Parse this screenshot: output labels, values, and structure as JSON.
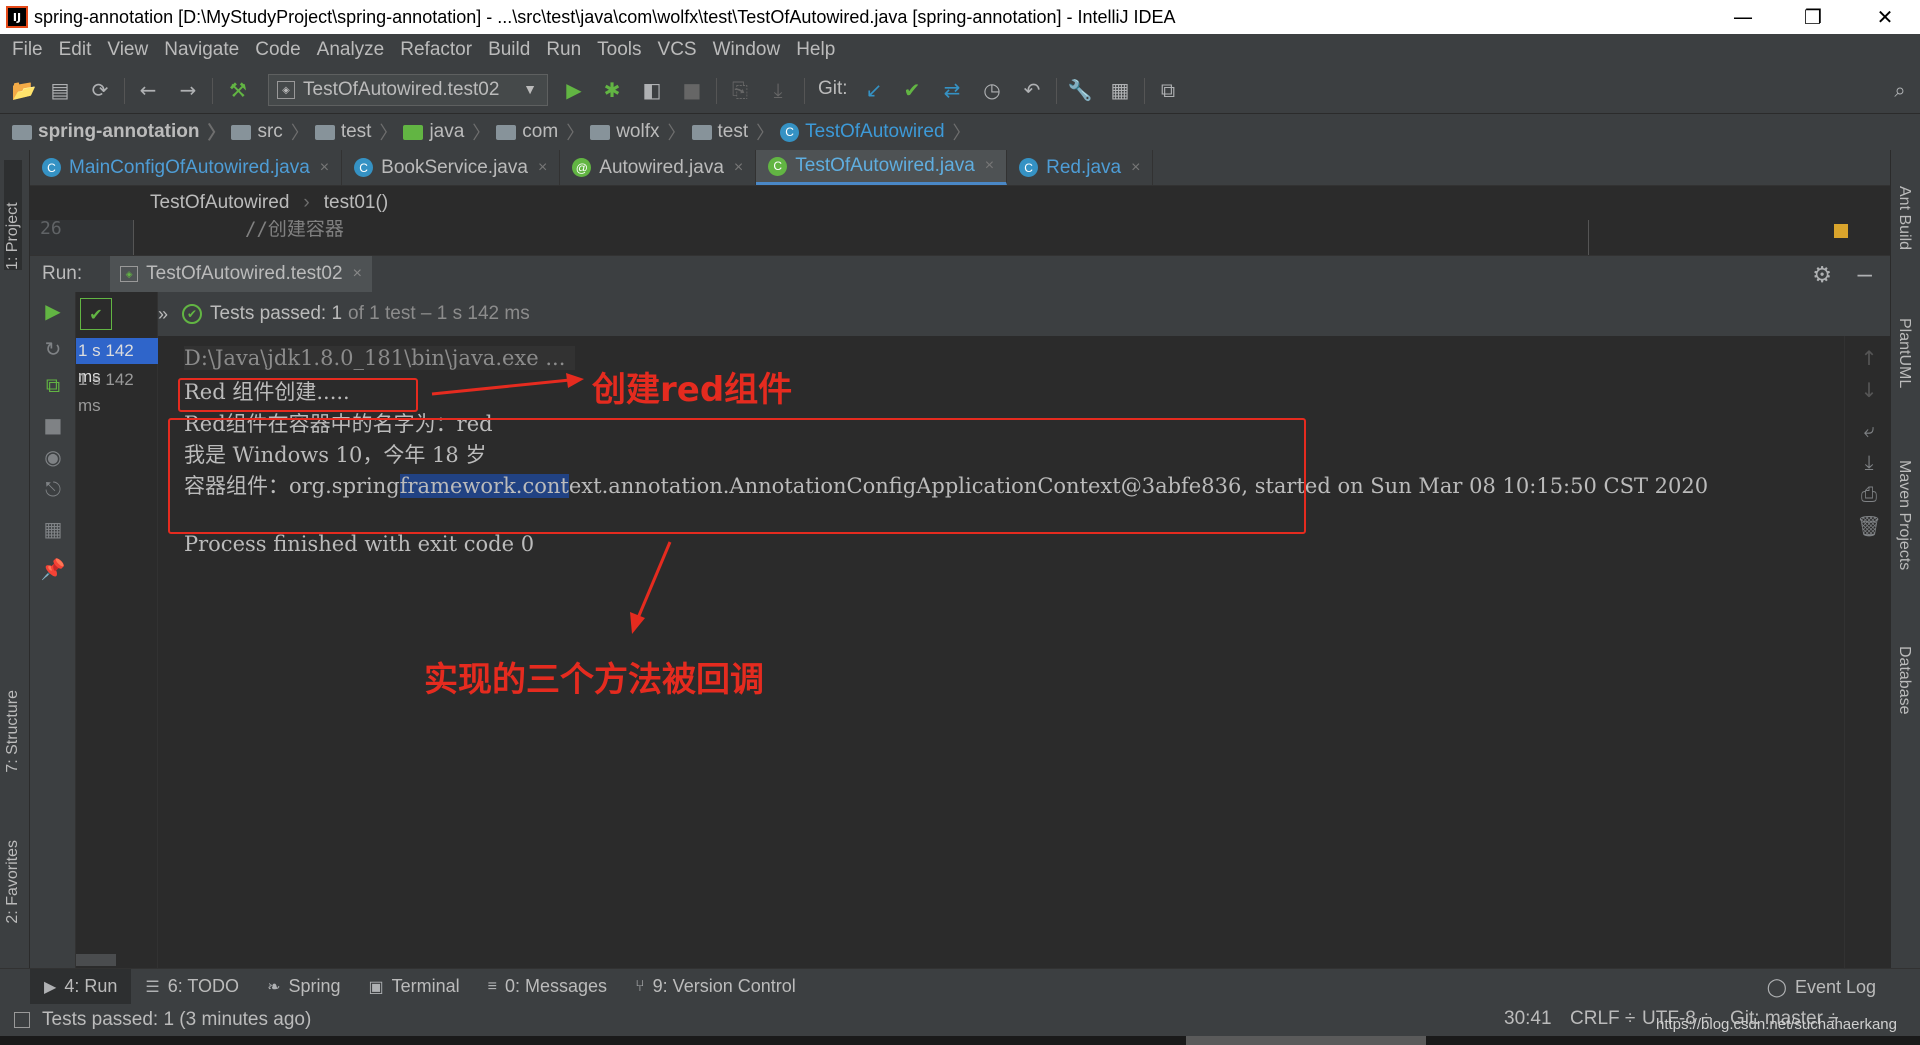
{
  "window": {
    "title": "spring-annotation [D:\\MyStudyProject\\spring-annotation] - ...\\src\\test\\java\\com\\wolfx\\test\\TestOfAutowired.java [spring-annotation] - IntelliJ IDEA",
    "app_icon": "IJ",
    "minimize": "—",
    "restore": "❐",
    "close": "✕"
  },
  "menu": [
    "File",
    "Edit",
    "View",
    "Navigate",
    "Code",
    "Analyze",
    "Refactor",
    "Build",
    "Run",
    "Tools",
    "VCS",
    "Window",
    "Help"
  ],
  "toolbar": {
    "run_config": "TestOfAutowired.test02",
    "git_label": "Git:"
  },
  "breadcrumb": [
    "spring-annotation",
    "src",
    "test",
    "java",
    "com",
    "wolfx",
    "test",
    "TestOfAutowired"
  ],
  "editor_tabs": [
    {
      "name": "MainConfigOfAutowired.java",
      "icon": "C"
    },
    {
      "name": "BookService.java",
      "icon": "C"
    },
    {
      "name": "Autowired.java",
      "icon": "@"
    },
    {
      "name": "TestOfAutowired.java",
      "icon": "C"
    },
    {
      "name": "Red.java",
      "icon": "C"
    }
  ],
  "editor": {
    "crumb_class": "TestOfAutowired",
    "crumb_method": "test01()",
    "line_number": "26",
    "code_line": "//创建容器"
  },
  "run_panel": {
    "label": "Run:",
    "tab": "TestOfAutowired.test02",
    "status_bold": "Tests passed: 1",
    "status_rest": "of 1 test – 1 s 142 ms",
    "tree_items": [
      "1 s 142 ms",
      "1 s 142 ms"
    ]
  },
  "console": {
    "cmd": "D:\\Java\\jdk1.8.0_181\\bin\\java.exe ...",
    "line1": "Red 组件创建.....",
    "line2": "Red组件在容器中的名字为：red",
    "line3": "我是 Windows 10，今年 18 岁",
    "line4_a": "容器组件：org.spring",
    "line4_sel": "framework.cont",
    "line4_b": "ext.annotation.AnnotationConfigApplicationContext@3abfe836,",
    "line4_c": "started on Sun Mar 08 10:15:50 CST 2020",
    "line5": "Process finished with exit code 0"
  },
  "annotations": {
    "label1": "创建red组件",
    "label2": "实现的三个方法被回调"
  },
  "left_strip": {
    "project": "1: Project",
    "structure": "7: Structure",
    "favorites": "2: Favorites"
  },
  "right_strip": {
    "ant": "Ant Build",
    "plantuml": "PlantUML",
    "maven": "Maven Projects",
    "database": "Database"
  },
  "bottom_tabs": [
    {
      "label": "4: Run",
      "icon": "▶"
    },
    {
      "label": "6: TODO",
      "icon": "☰"
    },
    {
      "label": "Spring",
      "icon": "❧"
    },
    {
      "label": "Terminal",
      "icon": "▣"
    },
    {
      "label": "0: Messages",
      "icon": "≡"
    },
    {
      "label": "9: Version Control",
      "icon": "⑂"
    }
  ],
  "event_log": "Event Log",
  "status_bar": {
    "message": "Tests passed: 1 (3 minutes ago)",
    "position": "30:41",
    "line_sep": "CRLF ÷",
    "encoding": "UTF-8 ÷",
    "git": "Git: master ÷"
  },
  "watermark": "https://blog.csdn.net/suchahaerkang",
  "colors": {
    "annotation_red": "#e52b1f",
    "selection": "#214283",
    "panel_bg": "#3c3f41",
    "editor_bg": "#2b2b2b"
  }
}
